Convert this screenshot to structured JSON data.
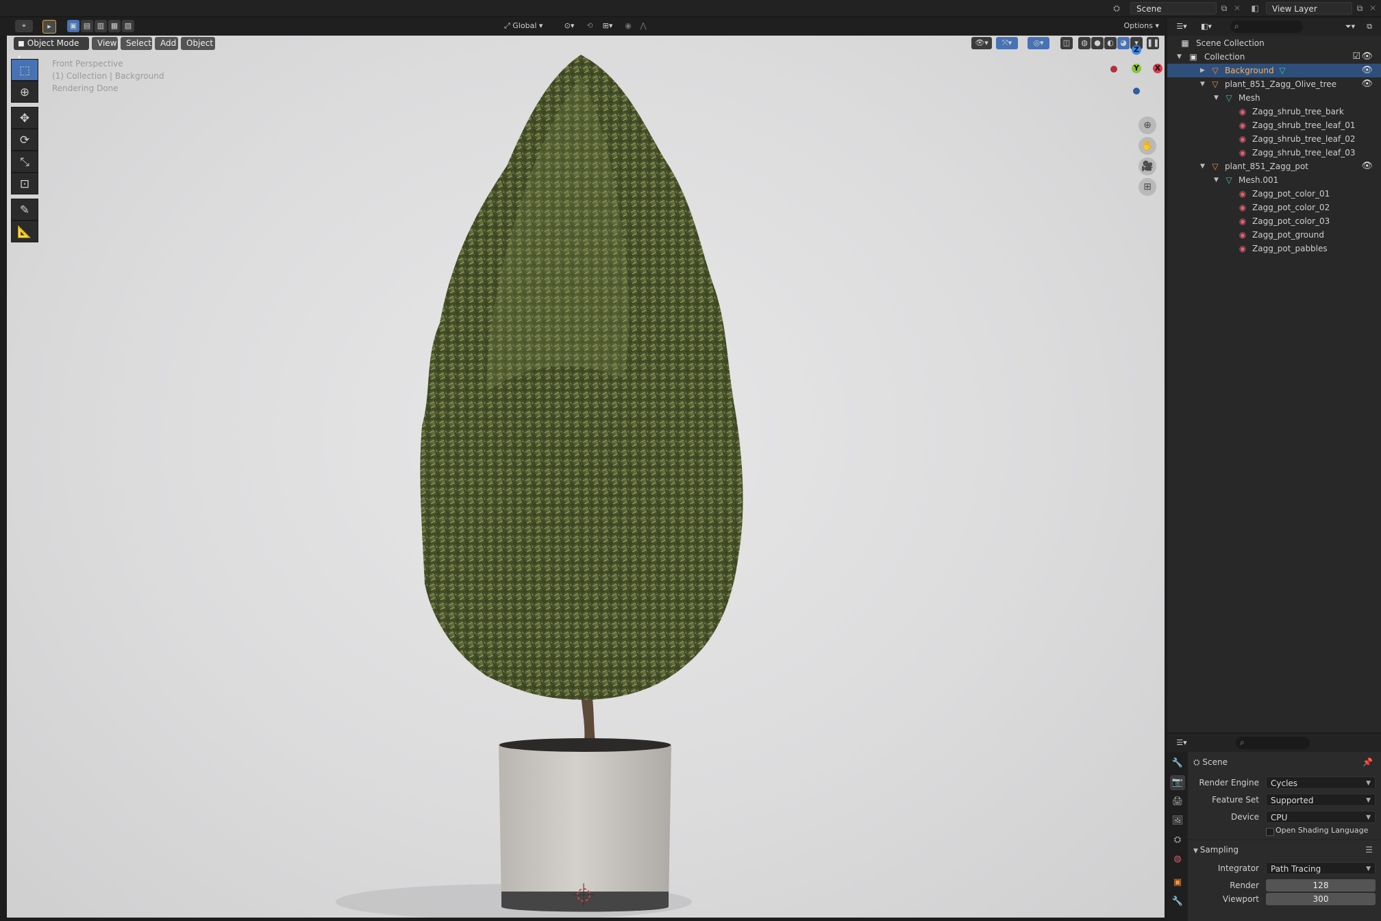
{
  "topbar": {
    "scene": "Scene",
    "view_layer": "View Layer",
    "transform_orientation": "Global",
    "options": "Options"
  },
  "header": {
    "mode": "Object Mode",
    "menus": [
      "View",
      "Select",
      "Add",
      "Object"
    ]
  },
  "viewport": {
    "info": [
      "Front Perspective",
      "(1) Collection | Background",
      "Rendering Done"
    ],
    "gizmo": {
      "z": "Z",
      "y": "Y",
      "x": "X"
    }
  },
  "outliner": {
    "rows": [
      {
        "label": "Scene Collection",
        "icon": "scene-collection-icon",
        "selected": false
      },
      {
        "label": "Collection",
        "icon": "collection-icon",
        "selected": false
      },
      {
        "label": "Background",
        "icon": "object-icon",
        "selected": true
      },
      {
        "label": "plant_851_Zagg_Olive_tree",
        "icon": "object-icon",
        "selected": false
      },
      {
        "label": "Mesh",
        "icon": "mesh-icon",
        "selected": false
      },
      {
        "label": "Zagg_shrub_tree_bark",
        "icon": "material-icon",
        "selected": false
      },
      {
        "label": "Zagg_shrub_tree_leaf_01",
        "icon": "material-icon",
        "selected": false
      },
      {
        "label": "Zagg_shrub_tree_leaf_02",
        "icon": "material-icon",
        "selected": false
      },
      {
        "label": "Zagg_shrub_tree_leaf_03",
        "icon": "material-icon",
        "selected": false
      },
      {
        "label": "plant_851_Zagg_pot",
        "icon": "object-icon",
        "selected": false
      },
      {
        "label": "Mesh.001",
        "icon": "mesh-icon",
        "selected": false
      },
      {
        "label": "Zagg_pot_color_01",
        "icon": "material-icon",
        "selected": false
      },
      {
        "label": "Zagg_pot_color_02",
        "icon": "material-icon",
        "selected": false
      },
      {
        "label": "Zagg_pot_color_03",
        "icon": "material-icon",
        "selected": false
      },
      {
        "label": "Zagg_pot_ground",
        "icon": "material-icon",
        "selected": false
      },
      {
        "label": "Zagg_pot_pabbles",
        "icon": "material-icon",
        "selected": false
      }
    ]
  },
  "properties": {
    "context": "Scene",
    "render_engine_label": "Render Engine",
    "render_engine": "Cycles",
    "feature_set_label": "Feature Set",
    "feature_set": "Supported",
    "device_label": "Device",
    "device": "CPU",
    "osl_label": "Open Shading Language",
    "sampling_label": "Sampling",
    "integrator_label": "Integrator",
    "integrator": "Path Tracing",
    "render_label": "Render",
    "render_samples": "128",
    "viewport_label": "Viewport",
    "viewport_samples": "300"
  },
  "colors": {
    "accent": "#4772b3",
    "selected_row": "#2f4f7a",
    "axis_x": "#e0374b",
    "axis_y": "#8cc33f",
    "axis_z": "#3d8be5"
  }
}
